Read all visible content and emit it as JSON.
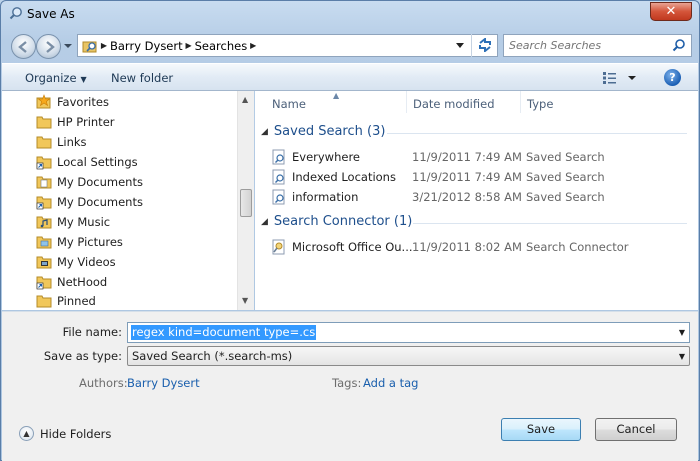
{
  "window": {
    "title": "Save As",
    "close_glyph": "✕"
  },
  "address": {
    "crumbs": [
      "Barry Dysert",
      "Searches"
    ],
    "search_placeholder": "Search Searches"
  },
  "toolbar": {
    "organize": "Organize",
    "new_folder": "New folder",
    "help": "?"
  },
  "nav_pane": {
    "items": [
      {
        "label": "Favorites",
        "icon": "star-folder-icon"
      },
      {
        "label": "HP Printer",
        "icon": "folder-icon"
      },
      {
        "label": "Links",
        "icon": "folder-icon"
      },
      {
        "label": "Local Settings",
        "icon": "shortcut-folder-icon"
      },
      {
        "label": "My Documents",
        "icon": "documents-folder-icon"
      },
      {
        "label": "My Documents",
        "icon": "shortcut-folder-icon"
      },
      {
        "label": "My Music",
        "icon": "music-folder-icon"
      },
      {
        "label": "My Pictures",
        "icon": "pictures-folder-icon"
      },
      {
        "label": "My Videos",
        "icon": "videos-folder-icon"
      },
      {
        "label": "NetHood",
        "icon": "shortcut-folder-icon"
      },
      {
        "label": "Pinned",
        "icon": "folder-icon"
      }
    ]
  },
  "file_pane": {
    "columns": {
      "name": "Name",
      "date": "Date modified",
      "type": "Type"
    },
    "groups": [
      {
        "title": "Saved Search (3)",
        "rows": [
          {
            "name": "Everywhere",
            "date": "11/9/2011 7:49 AM",
            "type": "Saved Search"
          },
          {
            "name": "Indexed Locations",
            "date": "11/9/2011 7:49 AM",
            "type": "Saved Search"
          },
          {
            "name": "information",
            "date": "3/21/2012 8:58 AM",
            "type": "Saved Search"
          }
        ]
      },
      {
        "title": "Search Connector (1)",
        "rows": [
          {
            "name": "Microsoft Office Ou...",
            "date": "11/9/2011 8:02 AM",
            "type": "Search Connector"
          }
        ]
      }
    ]
  },
  "details": {
    "file_name_label": "File name:",
    "file_name_value": "regex kind=document type=.cs",
    "save_type_label": "Save as type:",
    "save_type_value": "Saved Search (*.search-ms)",
    "authors_label": "Authors:",
    "authors_value": "Barry Dysert",
    "tags_label": "Tags:",
    "tags_value": "Add a tag",
    "hide_folders": "Hide Folders",
    "save": "Save",
    "cancel": "Cancel"
  },
  "colors": {
    "accent": "#1e4f8c",
    "link": "#1a5fad",
    "selection": "#3399ff"
  }
}
